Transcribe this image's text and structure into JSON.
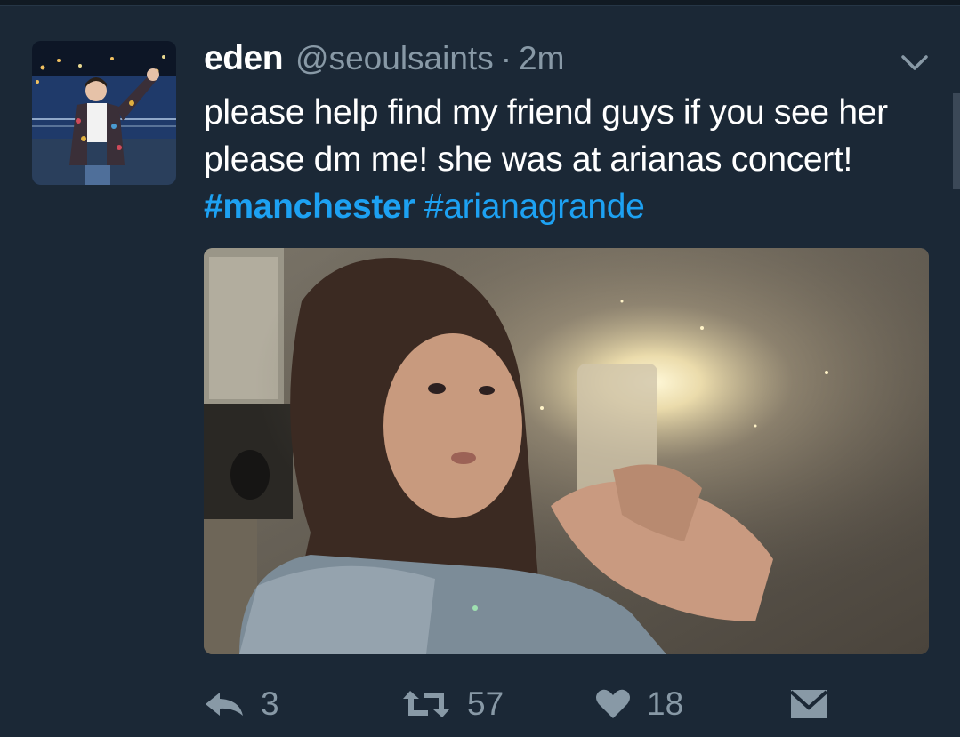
{
  "tweet": {
    "display_name": "eden",
    "handle": "@seoulsaints",
    "separator": "·",
    "time": "2m",
    "text_prefix": "please help find my friend guys if you see her please dm me! she was at arianas concert! ",
    "hashtags": [
      "#manchester",
      "#arianagrande"
    ],
    "hashtag_color": "#1da1f2"
  },
  "icons": {
    "menu": "chevron-down-icon",
    "reply": "reply-icon",
    "retweet": "retweet-icon",
    "like": "heart-icon",
    "dm": "envelope-icon"
  },
  "actions": {
    "reply_count": "3",
    "retweet_count": "57",
    "like_count": "18"
  },
  "colors": {
    "background": "#1b2836",
    "text": "#ffffff",
    "muted": "#8899a6",
    "link": "#1da1f2"
  }
}
